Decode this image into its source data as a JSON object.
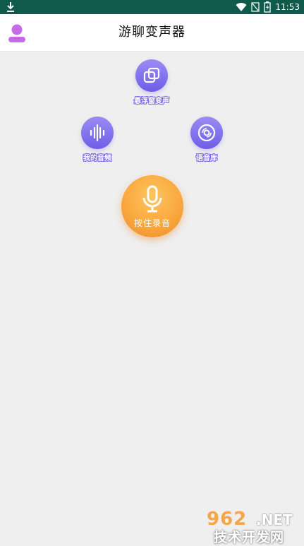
{
  "status_bar": {
    "time": "11:53",
    "icons": [
      "download-icon",
      "wifi-icon",
      "signal-off-icon",
      "battery-charging-icon"
    ]
  },
  "app_bar": {
    "title": "游聊变声器",
    "left_icon": "profile-icon"
  },
  "features": [
    {
      "label": "悬浮窗变声",
      "icon": "overlay-windows-icon"
    },
    {
      "label": "我的音频",
      "icon": "waveform-icon"
    },
    {
      "label": "语音库",
      "icon": "disc-icon"
    }
  ],
  "record": {
    "label": "按住录音",
    "icon": "microphone-icon"
  },
  "watermark": {
    "number": "962",
    "domain": ".NET",
    "caption": "技术开发网"
  },
  "colors": {
    "status_bar": "#0f5a4a",
    "purple_accent": "#7a6ae6",
    "profile_purple": "#c56ae8",
    "record_orange": "#f9a83e",
    "background": "#efefef"
  }
}
